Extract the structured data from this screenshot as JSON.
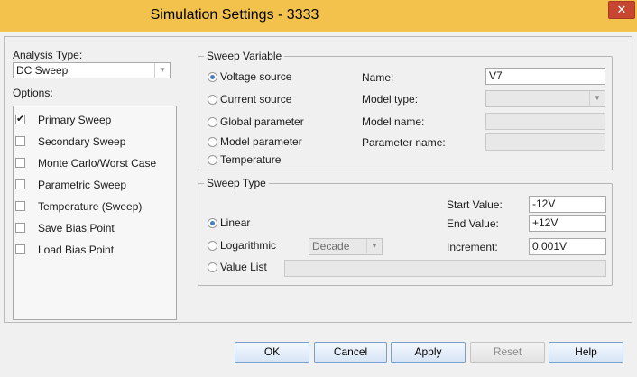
{
  "window": {
    "title": "Simulation Settings - 3333",
    "close_label": "✕"
  },
  "analysis": {
    "type_label": "Analysis Type:",
    "type_value": "DC Sweep",
    "options_label": "Options:",
    "options": [
      {
        "label": "Primary Sweep",
        "checked": true
      },
      {
        "label": "Secondary Sweep",
        "checked": false
      },
      {
        "label": "Monte Carlo/Worst Case",
        "checked": false
      },
      {
        "label": "Parametric Sweep",
        "checked": false
      },
      {
        "label": "Temperature (Sweep)",
        "checked": false
      },
      {
        "label": "Save Bias Point",
        "checked": false
      },
      {
        "label": "Load Bias Point",
        "checked": false
      }
    ]
  },
  "sweep_variable": {
    "title": "Sweep Variable",
    "radios": [
      {
        "label": "Voltage source",
        "selected": true
      },
      {
        "label": "Current source",
        "selected": false
      },
      {
        "label": "Global parameter",
        "selected": false
      },
      {
        "label": "Model parameter",
        "selected": false
      },
      {
        "label": "Temperature",
        "selected": false
      }
    ],
    "name_label": "Name:",
    "name_value": "V7",
    "model_type_label": "Model type:",
    "model_type_value": "",
    "model_name_label": "Model name:",
    "model_name_value": "",
    "parameter_name_label": "Parameter name:",
    "parameter_name_value": ""
  },
  "sweep_type": {
    "title": "Sweep Type",
    "linear_label": "Linear",
    "logarithmic_label": "Logarithmic",
    "value_list_label": "Value List",
    "selected": "Linear",
    "log_scale_value": "Decade",
    "value_list_value": "",
    "start_label": "Start Value:",
    "start_value": "-12V",
    "end_label": "End Value:",
    "end_value": "+12V",
    "increment_label": "Increment:",
    "increment_value": "0.001V"
  },
  "buttons": {
    "ok": "OK",
    "cancel": "Cancel",
    "apply": "Apply",
    "reset": "Reset",
    "help": "Help"
  },
  "colors": {
    "titlebar": "#f2c24c",
    "close_button": "#c7462f",
    "radio_selected": "#4a7ebc"
  }
}
